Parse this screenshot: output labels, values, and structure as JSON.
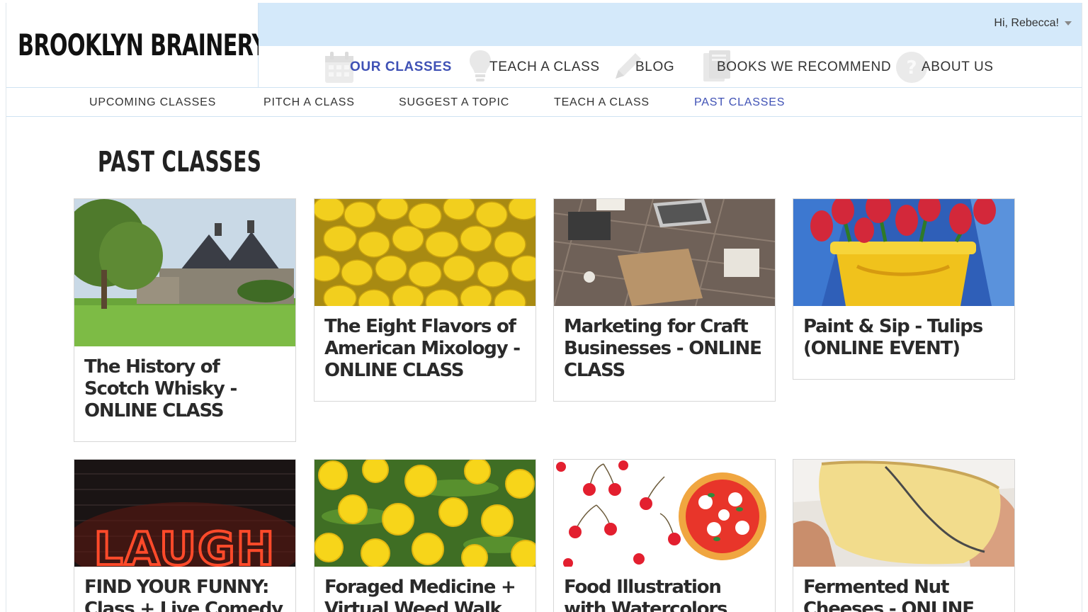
{
  "brand": {
    "logo_text": "BROOKLYN BRAINERY"
  },
  "user_menu": {
    "label": "Hi, Rebecca!"
  },
  "main_nav": {
    "items": [
      {
        "label": "OUR CLASSES",
        "icon": "calendar-icon",
        "active": true
      },
      {
        "label": "TEACH A CLASS",
        "icon": "lightbulb-icon",
        "active": false
      },
      {
        "label": "BLOG",
        "icon": "pencil-icon",
        "active": false
      },
      {
        "label": "BOOKS WE RECOMMEND",
        "icon": "books-icon",
        "active": false
      },
      {
        "label": "ABOUT US",
        "icon": "question-icon",
        "active": false
      }
    ]
  },
  "sub_nav": {
    "items": [
      {
        "label": "UPCOMING CLASSES",
        "active": false
      },
      {
        "label": "PITCH A CLASS",
        "active": false
      },
      {
        "label": "SUGGEST A TOPIC",
        "active": false
      },
      {
        "label": "TEACH A CLASS",
        "active": false
      },
      {
        "label": "PAST CLASSES",
        "active": true
      }
    ]
  },
  "page": {
    "title": "PAST CLASSES"
  },
  "classes": [
    {
      "title": "The History of Scotch Whisky - ONLINE CLASS",
      "image": "distillery-photo"
    },
    {
      "title": "The Eight Flavors of American Mixology - ONLINE CLASS",
      "image": "lemons-photo"
    },
    {
      "title": "Marketing for Craft Businesses - ONLINE CLASS",
      "image": "workspace-photo"
    },
    {
      "title": "Paint & Sip - Tulips (ONLINE EVENT)",
      "image": "tulips-painting"
    },
    {
      "title": "FIND YOUR FUNNY: Class + Live Comedy",
      "image": "laugh-neon-sign"
    },
    {
      "title": "Foraged Medicine + Virtual Weed Walk",
      "image": "dandelions-photo"
    },
    {
      "title": "Food Illustration with Watercolors",
      "image": "cherries-pizza-illustration"
    },
    {
      "title": "Fermented Nut Cheeses - ONLINE",
      "image": "nut-cheese-photo"
    }
  ],
  "colors": {
    "accent": "#3f51b5",
    "topbar": "#d4e9fa",
    "border": "#cfe2f2"
  }
}
